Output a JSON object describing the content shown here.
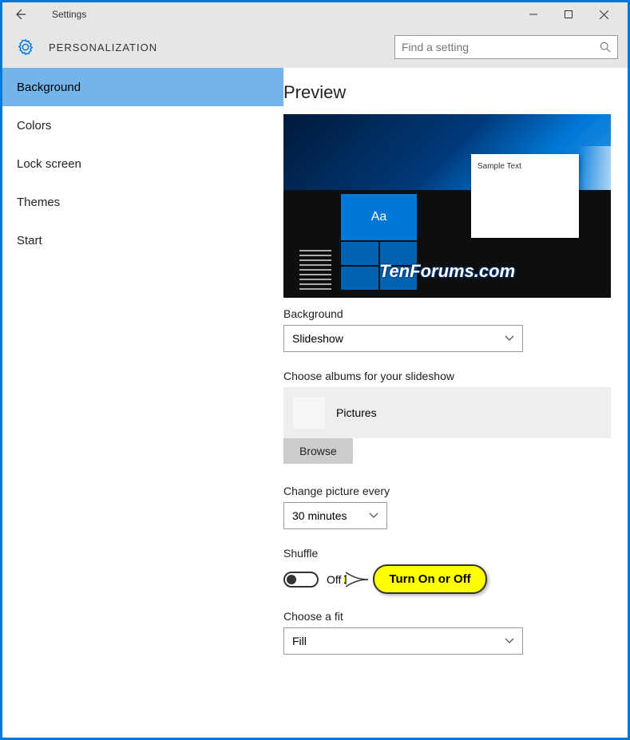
{
  "titlebar": {
    "title": "Settings"
  },
  "header": {
    "section": "PERSONALIZATION",
    "search_placeholder": "Find a setting"
  },
  "sidebar": {
    "items": [
      {
        "label": "Background",
        "active": true
      },
      {
        "label": "Colors",
        "active": false
      },
      {
        "label": "Lock screen",
        "active": false
      },
      {
        "label": "Themes",
        "active": false
      },
      {
        "label": "Start",
        "active": false
      }
    ]
  },
  "content": {
    "preview_heading": "Preview",
    "preview": {
      "tile_text": "Aa",
      "note_text": "Sample Text",
      "watermark": "TenForums.com"
    },
    "background_label": "Background",
    "background_value": "Slideshow",
    "albums_label": "Choose albums for your slideshow",
    "album_name": "Pictures",
    "browse_label": "Browse",
    "change_label": "Change picture every",
    "change_value": "30 minutes",
    "shuffle_label": "Shuffle",
    "shuffle_state": "Off",
    "callout_text": "Turn On or Off",
    "fit_label": "Choose a fit",
    "fit_value": "Fill"
  }
}
